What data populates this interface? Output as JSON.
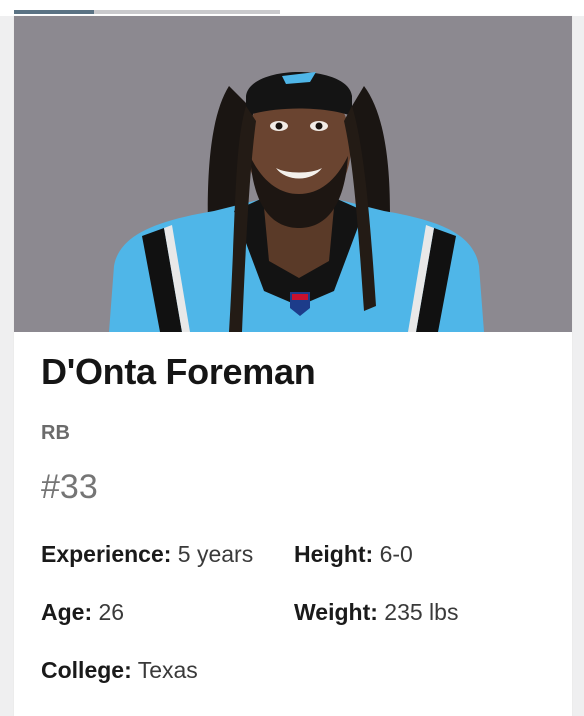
{
  "story_progress": {
    "fraction": 0.3
  },
  "player": {
    "name": "D'Onta Foreman",
    "position": "RB",
    "number": "#33",
    "jersey_color": "#4fb6e8",
    "stats": {
      "experience_label": "Experience:",
      "experience_value": "5 years",
      "height_label": "Height:",
      "height_value": "6-0",
      "age_label": "Age:",
      "age_value": "26",
      "weight_label": "Weight:",
      "weight_value": "235 lbs",
      "college_label": "College:",
      "college_value": "Texas"
    }
  }
}
